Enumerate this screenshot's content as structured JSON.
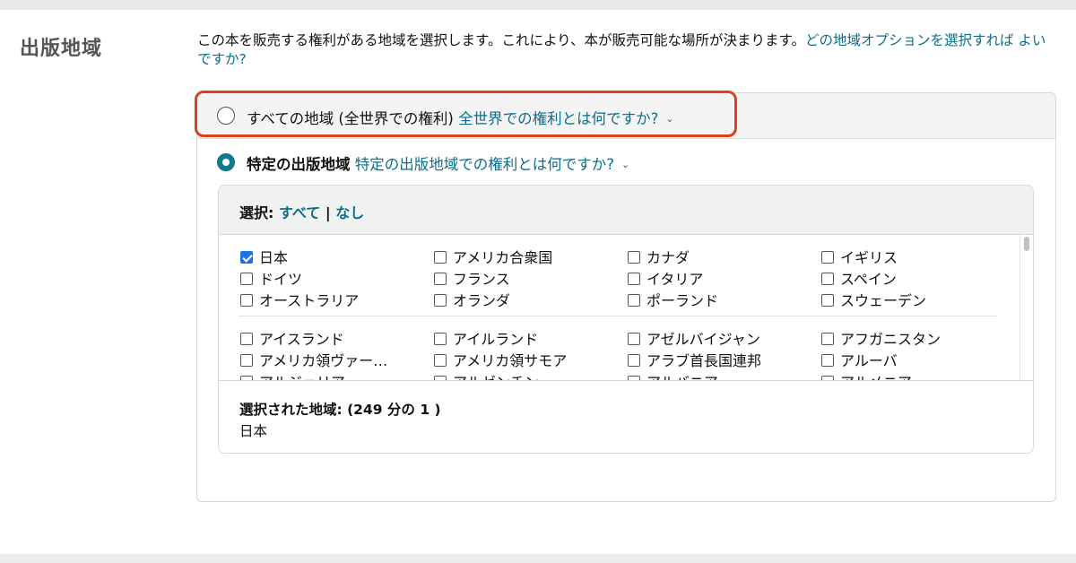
{
  "section": {
    "title": "出版地域"
  },
  "intro": {
    "text": "この本を販売する権利がある地域を選択します。これにより、本が販売可能な場所が決まります。",
    "help_link": "どの地域オプションを選択すれば よいですか?"
  },
  "option_all": {
    "label": "すべての地域 (全世界での権利)",
    "help_link": "全世界での権利とは何ですか?",
    "selected": false
  },
  "option_specific": {
    "label": "特定の出版地域",
    "help_link": "特定の出版地域での権利とは何ですか?",
    "selected": true
  },
  "select_bar": {
    "label": "選択:",
    "all": "すべて",
    "separator": "|",
    "none": "なし"
  },
  "countries_featured": [
    {
      "name": "日本",
      "checked": true
    },
    {
      "name": "アメリカ合衆国",
      "checked": false
    },
    {
      "name": "カナダ",
      "checked": false
    },
    {
      "name": "イギリス",
      "checked": false
    },
    {
      "name": "ドイツ",
      "checked": false
    },
    {
      "name": "フランス",
      "checked": false
    },
    {
      "name": "イタリア",
      "checked": false
    },
    {
      "name": "スペイン",
      "checked": false
    },
    {
      "name": "オーストラリア",
      "checked": false
    },
    {
      "name": "オランダ",
      "checked": false
    },
    {
      "name": "ポーランド",
      "checked": false
    },
    {
      "name": "スウェーデン",
      "checked": false
    }
  ],
  "countries_all": [
    {
      "name": "アイスランド",
      "checked": false
    },
    {
      "name": "アイルランド",
      "checked": false
    },
    {
      "name": "アゼルバイジャン",
      "checked": false
    },
    {
      "name": "アフガニスタン",
      "checked": false
    },
    {
      "name": "アメリカ領ヴァー…",
      "checked": false
    },
    {
      "name": "アメリカ領サモア",
      "checked": false
    },
    {
      "name": "アラブ首長国連邦",
      "checked": false
    },
    {
      "name": "アルーバ",
      "checked": false
    },
    {
      "name": "アルジェリア",
      "checked": false
    },
    {
      "name": "アルゼンチン",
      "checked": false
    },
    {
      "name": "アルバニア",
      "checked": false
    },
    {
      "name": "アルメニア",
      "checked": false
    }
  ],
  "selected_summary": {
    "title": "選択された地域: (249 分の 1 )",
    "value": "日本"
  },
  "colors": {
    "accent": "#0f7a8c",
    "link": "#0b6e8a",
    "highlight": "#d8421f",
    "checkbox_checked": "#1a73e8"
  }
}
